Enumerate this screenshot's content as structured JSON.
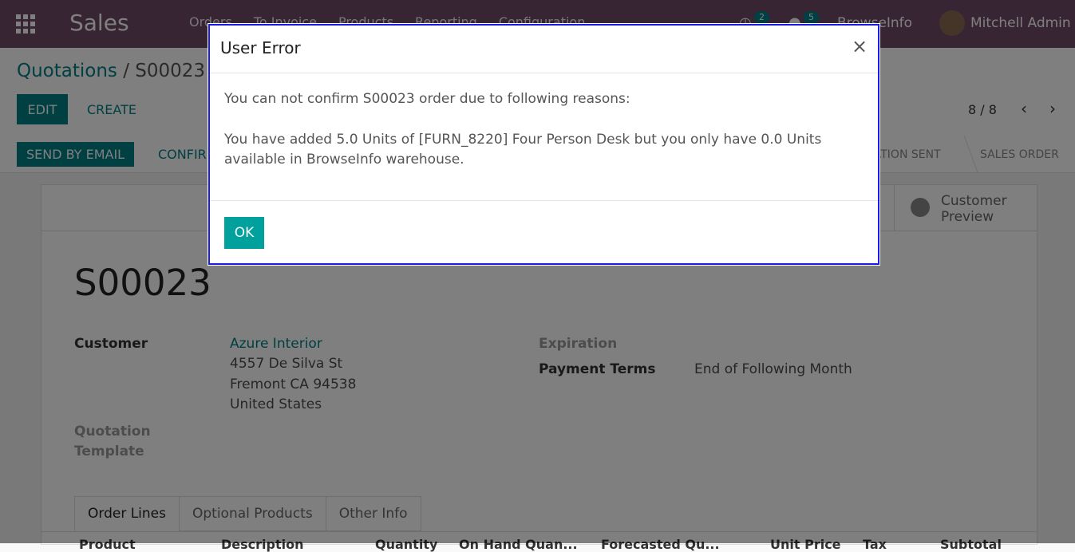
{
  "topbar": {
    "app_name": "Sales",
    "menu": [
      "Orders",
      "To Invoice",
      "Products",
      "Reporting",
      "Configuration"
    ],
    "activity_count": "2",
    "messages_count": "5",
    "company": "BrowseInfo",
    "user": "Mitchell Admin"
  },
  "breadcrumb": {
    "parent": "Quotations",
    "separator": "/",
    "current": "S00023"
  },
  "actions": {
    "edit": "EDIT",
    "create": "CREATE"
  },
  "pager": {
    "value": "8 / 8"
  },
  "status": {
    "send_email": "SEND BY EMAIL",
    "confirm": "CONFIRM",
    "stages": [
      "QUOTATION SENT",
      "SALES ORDER"
    ]
  },
  "sheet": {
    "preview": "Customer Preview",
    "name": "S00023",
    "customer_label": "Customer",
    "customer_name": "Azure Interior",
    "customer_address": [
      "4557 De Silva St",
      "Fremont CA 94538",
      "United States"
    ],
    "template_label": "Quotation Template",
    "expiration_label": "Expiration",
    "payment_terms_label": "Payment Terms",
    "payment_terms_value": "End of Following Month",
    "tabs": [
      "Order Lines",
      "Optional Products",
      "Other Info"
    ],
    "columns": [
      "Product",
      "Description",
      "Quantity",
      "On Hand Quan...",
      "Forecasted Qu...",
      "Unit Price",
      "Tax",
      "Subtotal"
    ]
  },
  "dialog": {
    "title": "User Error",
    "close": "×",
    "message1": "You can not confirm S00023 order due to following reasons:",
    "message2": "You have added 5.0 Units of [FURN_8220] Four Person Desk but you only have 0.0 Units available in BrowseInfo warehouse.",
    "ok": "OK"
  },
  "colors": {
    "brand": "#714b67",
    "primary": "#017e84",
    "ok_button": "#00a09d",
    "highlight": "#1a1ae6"
  }
}
